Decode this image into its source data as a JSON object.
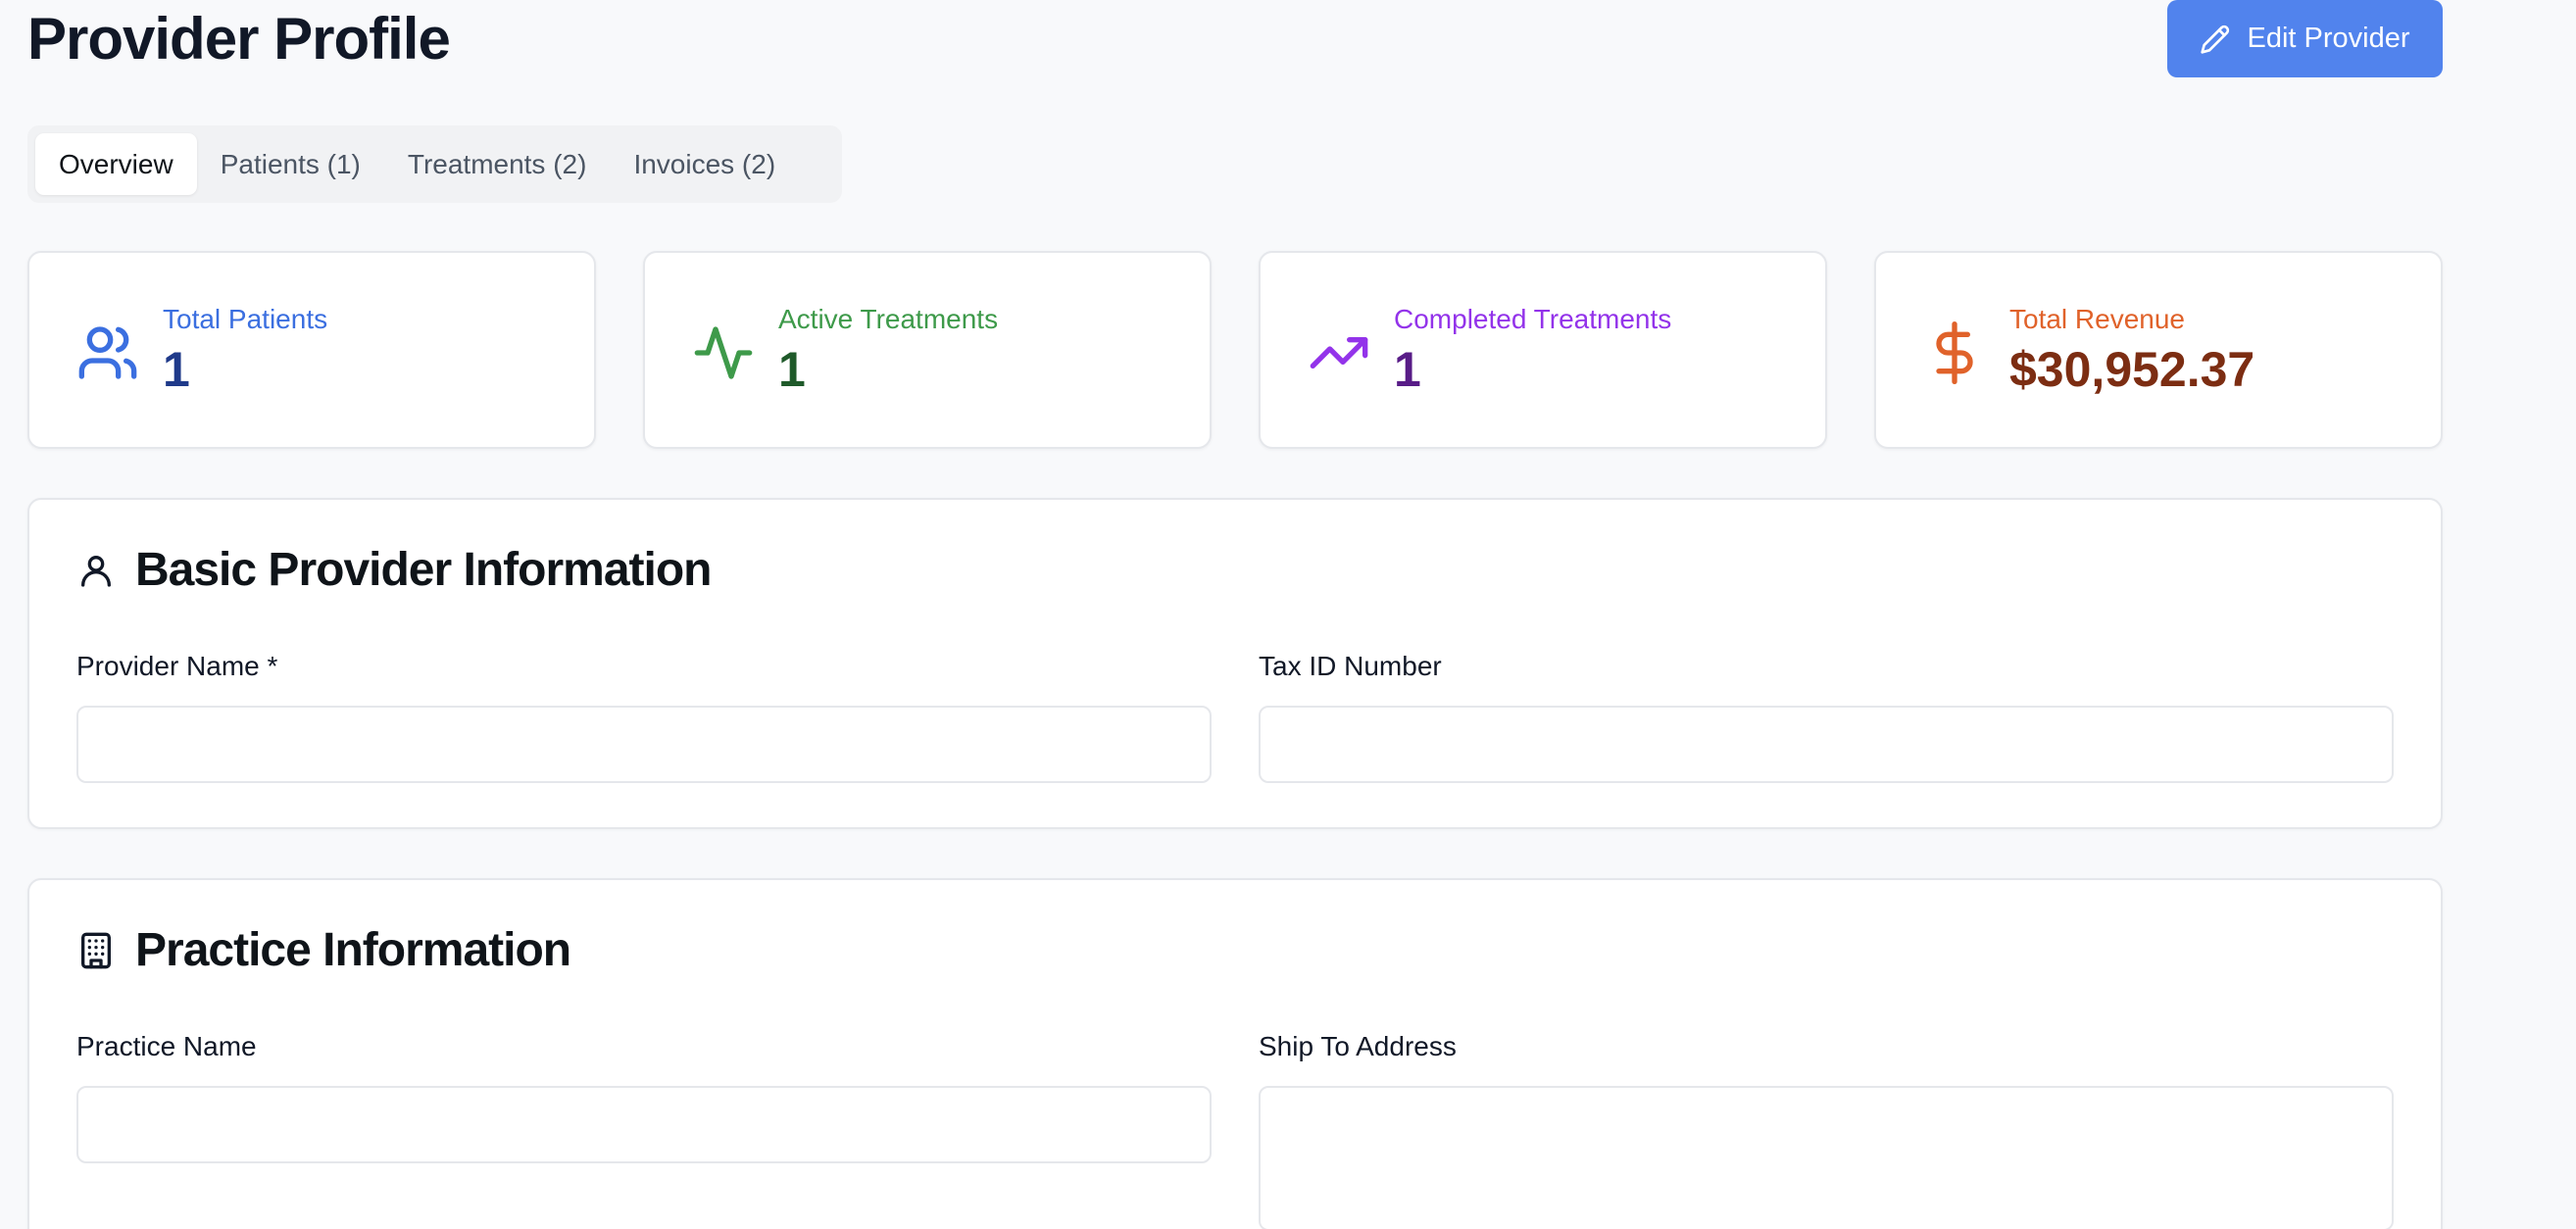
{
  "header": {
    "title": "Provider Profile",
    "edit_button_label": "Edit Provider"
  },
  "tabs": [
    {
      "label": "Overview",
      "active": true
    },
    {
      "label": "Patients (1)",
      "active": false
    },
    {
      "label": "Treatments (2)",
      "active": false
    },
    {
      "label": "Invoices (2)",
      "active": false
    }
  ],
  "stats": [
    {
      "label": "Total Patients",
      "value": "1",
      "icon": "users-icon",
      "label_color": "#3b6fe0",
      "value_color": "#1f3a8a"
    },
    {
      "label": "Active Treatments",
      "value": "1",
      "icon": "activity-icon",
      "label_color": "#3e9a4a",
      "value_color": "#1f5a2a"
    },
    {
      "label": "Completed Treatments",
      "value": "1",
      "icon": "trending-up-icon",
      "label_color": "#9333ea",
      "value_color": "#581c87"
    },
    {
      "label": "Total Revenue",
      "value": "$30,952.37",
      "icon": "dollar-icon",
      "label_color": "#e0622a",
      "value_color": "#7c2d12"
    }
  ],
  "basic_info": {
    "title": "Basic Provider Information",
    "icon": "user-icon",
    "provider_name_label": "Provider Name *",
    "provider_name_value": "",
    "tax_id_label": "Tax ID Number",
    "tax_id_value": ""
  },
  "practice_info": {
    "title": "Practice Information",
    "icon": "building-icon",
    "practice_name_label": "Practice Name",
    "practice_name_value": "",
    "ship_to_label": "Ship To Address",
    "ship_to_value": ""
  },
  "colors": {
    "accent": "#5183ed",
    "background": "#f8f9fb"
  }
}
